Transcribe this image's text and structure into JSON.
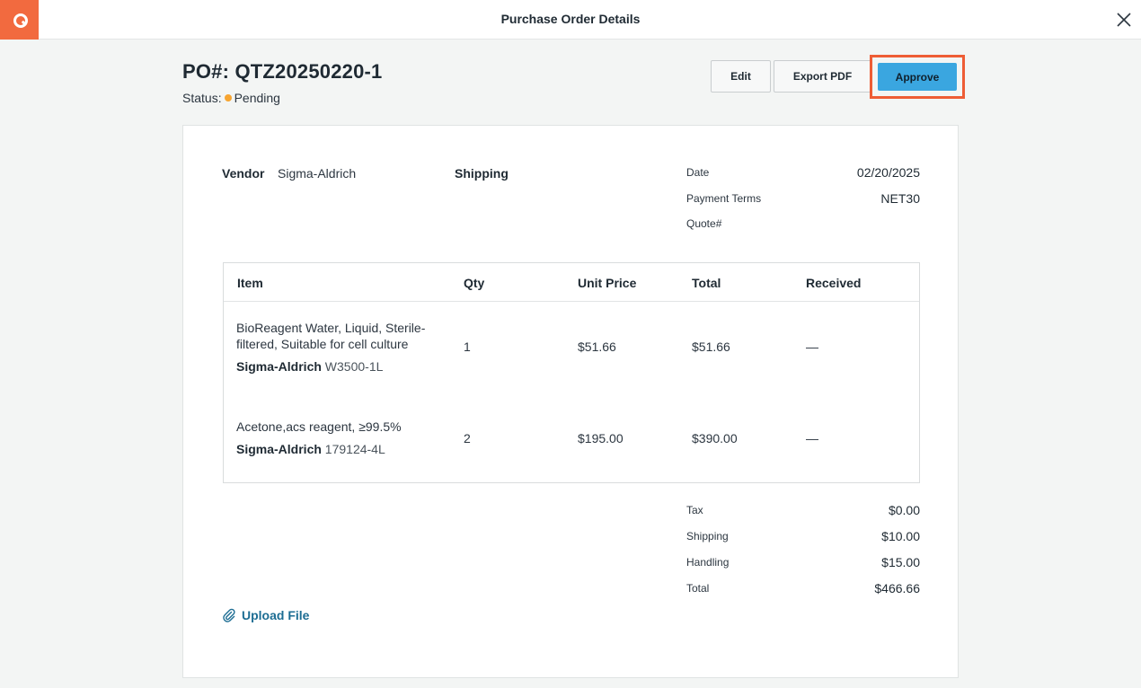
{
  "header": {
    "title": "Purchase Order Details"
  },
  "po": {
    "number": "PO#: QTZ20250220-1",
    "status_label": "Status:",
    "status_value": "Pending",
    "status_color": "#f7a531"
  },
  "actions": {
    "edit_label": "Edit",
    "export_label": "Export PDF",
    "approve_label": "Approve"
  },
  "details": {
    "vendor_label": "Vendor",
    "vendor_value": "Sigma-Aldrich",
    "shipping_label": "Shipping",
    "date_label": "Date",
    "date_value": "02/20/2025",
    "terms_label": "Payment Terms",
    "terms_value": "NET30",
    "quote_label": "Quote#"
  },
  "table": {
    "headers": [
      "Item",
      "Qty",
      "Unit Price",
      "Total",
      "Received"
    ],
    "rows": [
      {
        "name": "BioReagent Water, Liquid, Sterile-filtered, Suitable for cell culture",
        "vendor": "Sigma-Aldrich",
        "catalog": "W3500-1L",
        "qty": "1",
        "unit_price": "$51.66",
        "total": "$51.66",
        "received": "—"
      },
      {
        "name": "Acetone,acs reagent, ≥99.5%",
        "vendor": "Sigma-Aldrich",
        "catalog": "179124-4L",
        "qty": "2",
        "unit_price": "$195.00",
        "total": "$390.00",
        "received": "—"
      }
    ]
  },
  "summary": {
    "tax_label": "Tax",
    "tax_value": "$0.00",
    "shipping_label": "Shipping",
    "shipping_value": "$10.00",
    "handling_label": "Handling",
    "handling_value": "$15.00",
    "total_label": "Total",
    "total_value": "$466.66"
  },
  "upload": {
    "label": "Upload File",
    "icon": "paperclip-icon"
  },
  "colors": {
    "brand": "#f26a3f",
    "primary_button": "#3aa6e0",
    "link": "#1d6d93",
    "highlight_border": "#ee5d35"
  }
}
